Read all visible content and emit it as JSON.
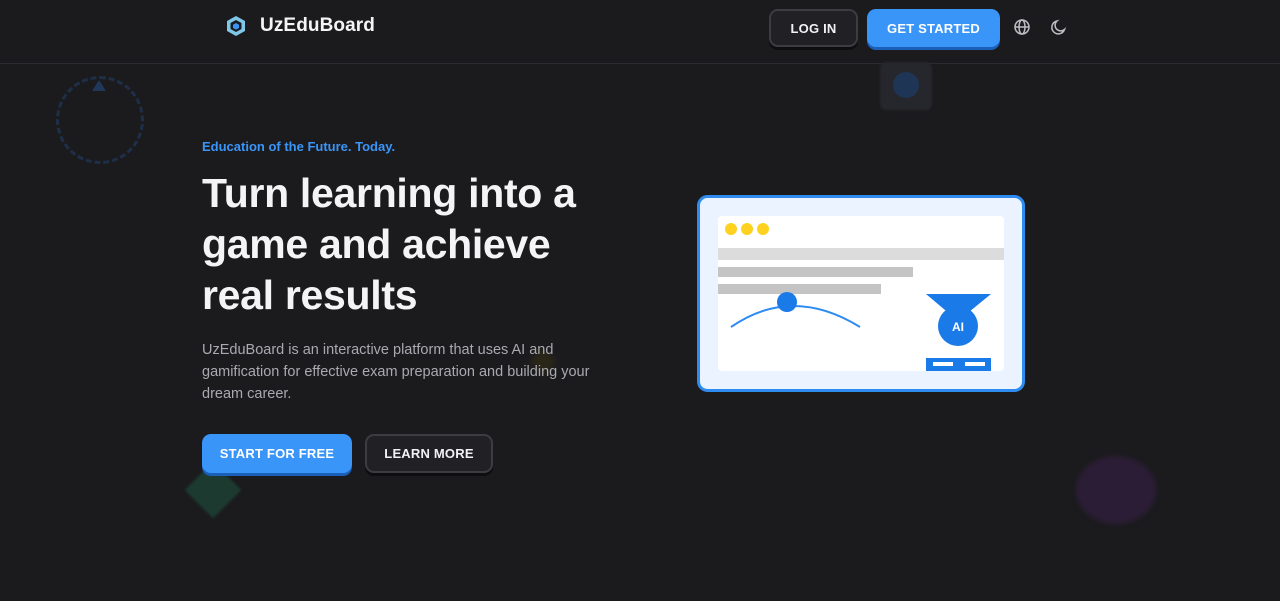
{
  "header": {
    "brand_name": "UzEduBoard",
    "login_label": "LOG IN",
    "get_started_label": "GET STARTED",
    "globe_icon": "globe-icon",
    "theme_icon": "moon-icon"
  },
  "hero": {
    "eyebrow": "Education of the Future. Today.",
    "headline": "Turn learning into a game and achieve real results",
    "description": "UzEduBoard is an interactive platform that uses AI and gamification for effective exam preparation and building your dream career.",
    "start_label": "START FOR FREE",
    "learn_label": "LEARN MORE"
  },
  "illustration": {
    "badge_label": "AI"
  },
  "colors": {
    "background": "#1b1b1e",
    "accent": "#3a95f8",
    "window_dots": "#ffd21f"
  }
}
